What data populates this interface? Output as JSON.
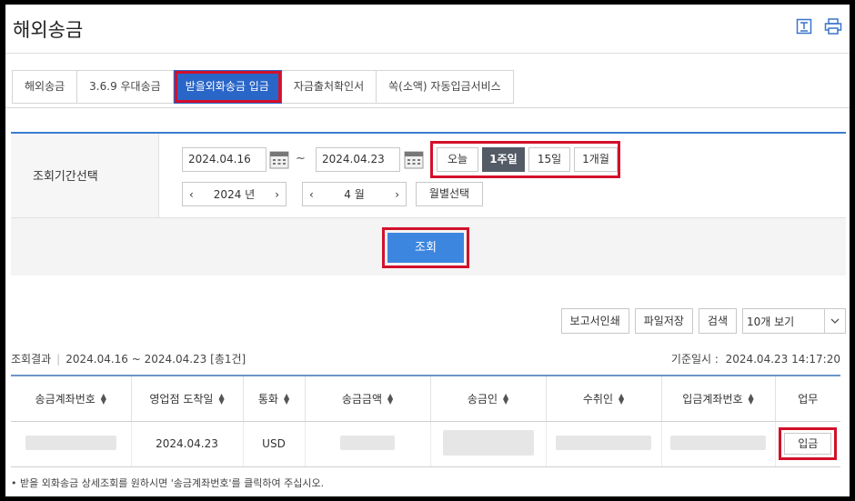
{
  "page": {
    "title": "해외송금"
  },
  "header": {
    "icons": [
      "excel-download-icon",
      "print-icon"
    ]
  },
  "tabs": [
    {
      "label": "해외송금",
      "active": false
    },
    {
      "label": "3.6.9 우대송금",
      "active": false
    },
    {
      "label": "받을외화송금 입금",
      "active": true
    },
    {
      "label": "자금출처확인서",
      "active": false
    },
    {
      "label": "쏙(소액) 자동입금서비스",
      "active": false
    }
  ],
  "search": {
    "label": "조회기간선택",
    "start_date": "2024.04.16",
    "separator": "~",
    "end_date": "2024.04.23",
    "periods": [
      {
        "label": "오늘",
        "active": false
      },
      {
        "label": "1주일",
        "active": true
      },
      {
        "label": "15일",
        "active": false
      },
      {
        "label": "1개월",
        "active": false
      }
    ],
    "year": "2024 년",
    "month": "4 월",
    "prev": "‹",
    "next": "›",
    "monthly_label": "월별선택",
    "query_label": "조회"
  },
  "toolbar": {
    "report_print": "보고서인쇄",
    "save_file": "파일저장",
    "search": "검색",
    "page_size": "10개 보기"
  },
  "result": {
    "label": "조회결과",
    "range": "2024.04.16 ~ 2024.04.23 [총1건]",
    "base_label": "기준일시 :",
    "base_time": "2024.04.23 14:17:20"
  },
  "table": {
    "columns": [
      "송금계좌번호",
      "영업점 도착일",
      "통화",
      "송금금액",
      "송금인",
      "수취인",
      "입금계좌번호",
      "업무"
    ],
    "rows": [
      {
        "arrival_date": "2024.04.23",
        "currency": "USD",
        "action": "입금"
      }
    ]
  },
  "note": "받을 외화송금 상세조회를 원하시면 '송금계좌번호'를 클릭하여 주십시오.",
  "colors": {
    "accent": "#2a66c8",
    "highlight": "#d3102a",
    "query_button": "#3d86e0"
  }
}
